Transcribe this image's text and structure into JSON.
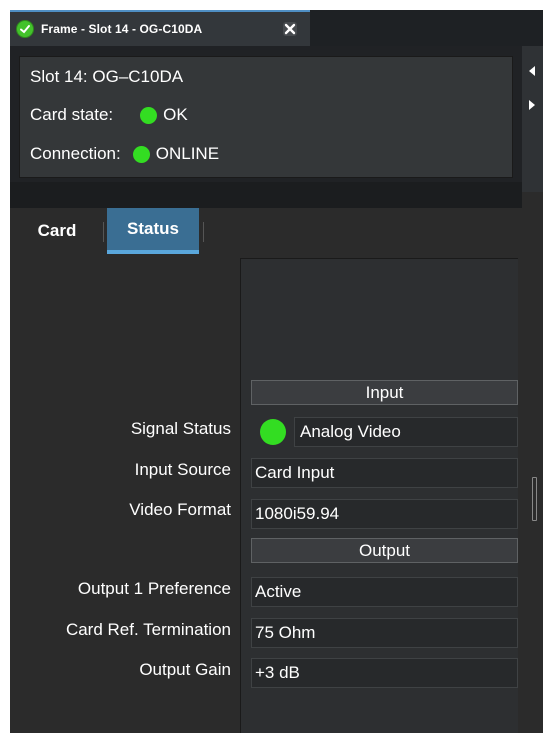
{
  "window_tab": {
    "title": "Frame - Slot 14 - OG-C10DA",
    "status_icon": "check-circle-icon",
    "close_icon": "close-icon"
  },
  "card_info": {
    "slot": "Slot 14: OG–C10DA",
    "card_state_label": "Card state:",
    "card_state_value": "OK",
    "connection_label": "Connection:",
    "connection_value": "ONLINE",
    "led_color": "#33dd22"
  },
  "tabs": [
    {
      "label": "Card",
      "active": false
    },
    {
      "label": "Status",
      "active": true
    }
  ],
  "status": {
    "input_header": "Input",
    "output_header": "Output",
    "rows": [
      {
        "label": "Signal Status",
        "value": "Analog Video"
      },
      {
        "label": "Input Source",
        "value": "Card Input"
      },
      {
        "label": "Video Format",
        "value": "1080i59.94"
      },
      {
        "label": "Output 1 Preference",
        "value": "Active"
      },
      {
        "label": "Card Ref. Termination",
        "value": "75 Ohm"
      },
      {
        "label": "Output Gain",
        "value": "+3 dB"
      }
    ]
  },
  "colors": {
    "accent": "#5aa7dc",
    "ok_green": "#33dd22",
    "panel_bg": "#2b2b2b"
  }
}
